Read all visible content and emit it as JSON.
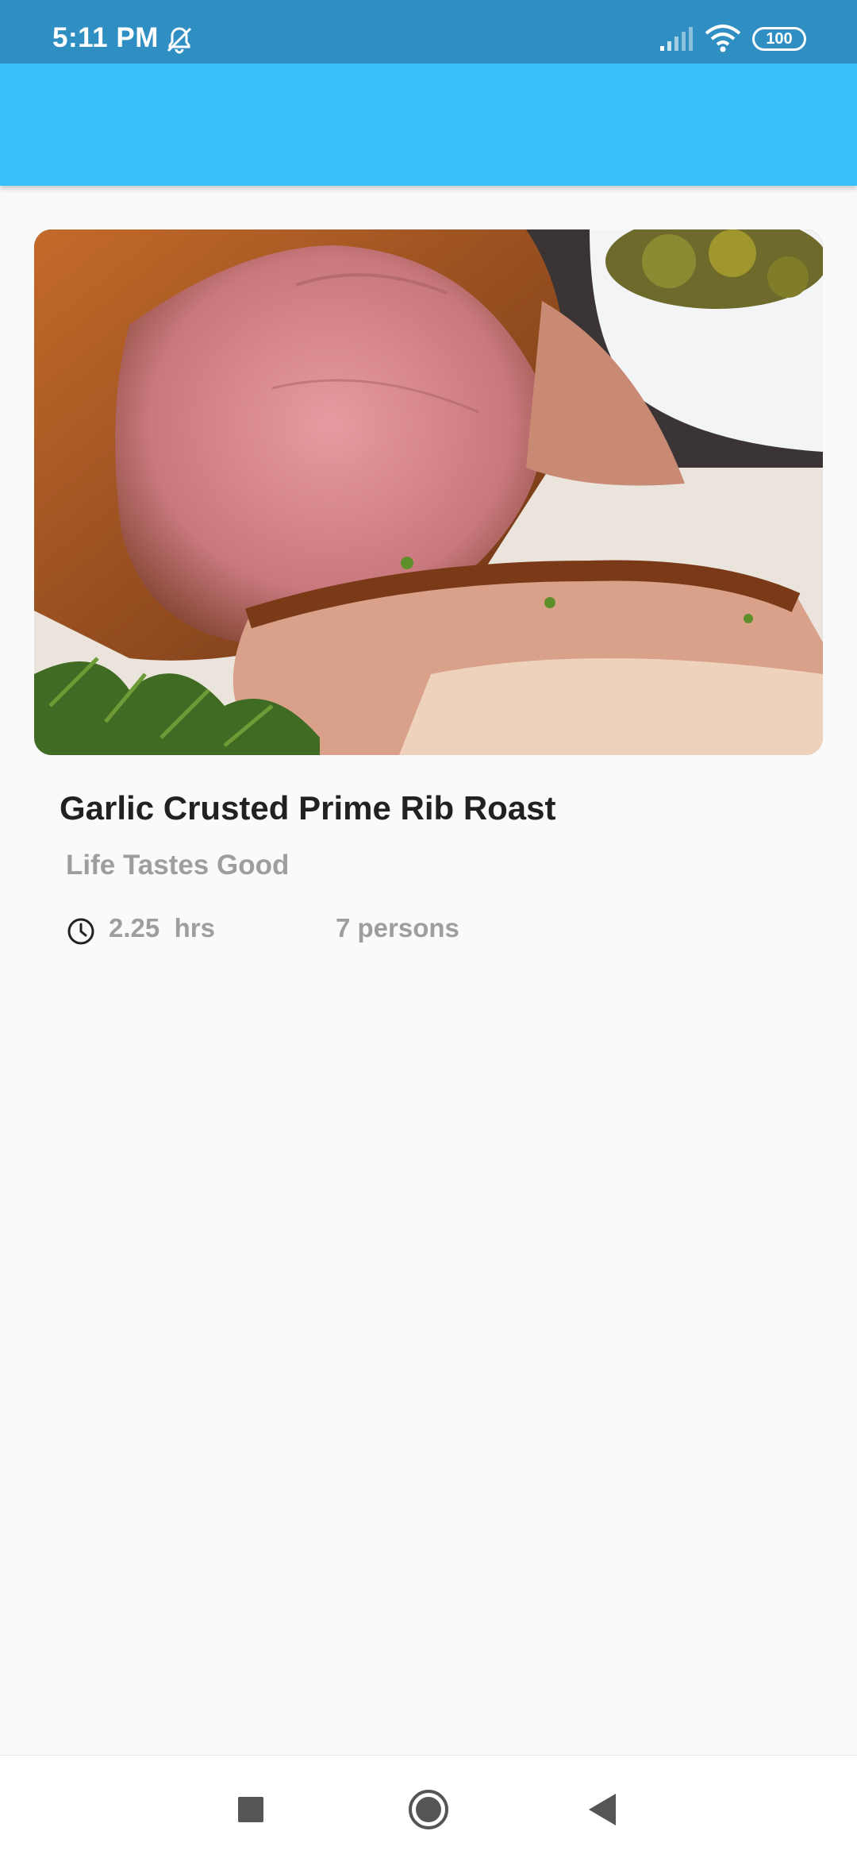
{
  "status_bar": {
    "time": "5:11 PM",
    "battery": "100",
    "icons": [
      "mute-notifications-icon",
      "cellular-signal-icon",
      "wifi-icon",
      "battery-icon"
    ]
  },
  "colors": {
    "status_bar": "#2f8fc3",
    "app_bar": "#3bbff9",
    "background": "#fafafa",
    "title": "#212121",
    "secondary_text": "#9e9e9e"
  },
  "recipe": {
    "image_alt": "Garlic Crusted Prime Rib Roast",
    "title": "Garlic Crusted Prime Rib Roast",
    "subtitle": "Life Tastes Good",
    "duration": "2.25  hrs",
    "servings": "7 persons",
    "duration_icon": "clock-icon"
  },
  "navigation": {
    "buttons": [
      "recents-icon",
      "home-icon",
      "back-icon"
    ]
  }
}
